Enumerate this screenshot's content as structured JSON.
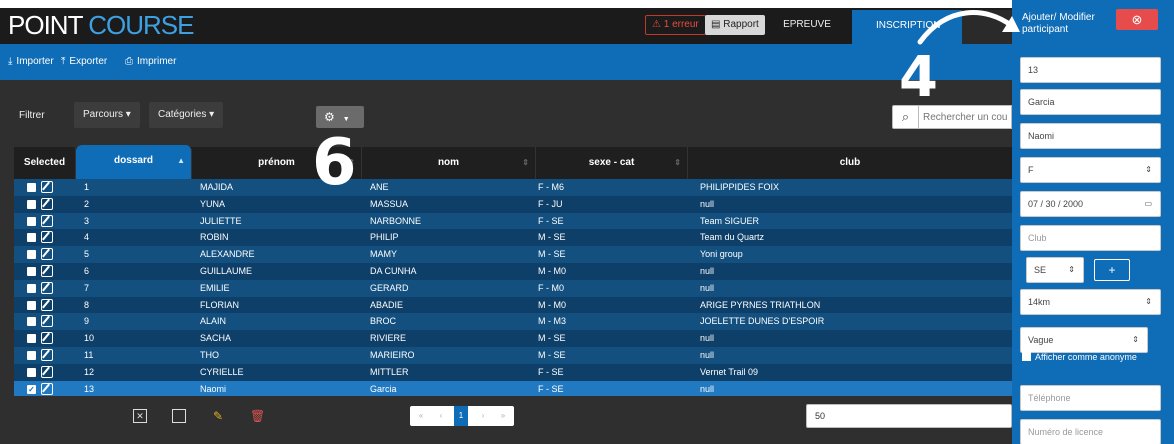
{
  "app": {
    "logo_part1": "POINT",
    "logo_part2": "COURSE"
  },
  "topnav": {
    "errors_label": "1 erreur",
    "report_label": "Rapport",
    "tab_epreuve": "EPREUVE",
    "tab_inscription": "INSCRIPTION"
  },
  "toolbar": {
    "import_label": "Importer",
    "export_label": "Exporter",
    "print_label": "Imprimer"
  },
  "filters": {
    "label": "Filtrer",
    "parcours_label": "Parcours",
    "categories_label": "Catégories"
  },
  "search": {
    "placeholder": "Rechercher un cou"
  },
  "table": {
    "columns": [
      "Selected",
      "dossard",
      "prénom",
      "nom",
      "sexe - cat",
      "club"
    ],
    "rows": [
      {
        "dossard": "1",
        "prenom": "MAJIDA",
        "nom": "ANE",
        "sexe_cat": "F - M6",
        "club": "PHILIPPIDES FOIX",
        "checked": false
      },
      {
        "dossard": "2",
        "prenom": "YUNA",
        "nom": "MASSUA",
        "sexe_cat": "F - JU",
        "club": "null",
        "checked": false
      },
      {
        "dossard": "3",
        "prenom": "JULIETTE",
        "nom": "NARBONNE",
        "sexe_cat": "F - SE",
        "club": "Team SIGUER",
        "checked": false
      },
      {
        "dossard": "4",
        "prenom": "ROBIN",
        "nom": "PHILIP",
        "sexe_cat": "M - SE",
        "club": "Team du Quartz",
        "checked": false
      },
      {
        "dossard": "5",
        "prenom": "ALEXANDRE",
        "nom": "MAMY",
        "sexe_cat": "M - SE",
        "club": "Yoni group",
        "checked": false
      },
      {
        "dossard": "6",
        "prenom": "GUILLAUME",
        "nom": "DA CUNHA",
        "sexe_cat": "M - M0",
        "club": "null",
        "checked": false
      },
      {
        "dossard": "7",
        "prenom": "EMILIE",
        "nom": "GERARD",
        "sexe_cat": "F - M0",
        "club": "null",
        "checked": false
      },
      {
        "dossard": "8",
        "prenom": "FLORIAN",
        "nom": "ABADIE",
        "sexe_cat": "M - M0",
        "club": "ARIGE PYRNES TRIATHLON",
        "checked": false
      },
      {
        "dossard": "9",
        "prenom": "ALAIN",
        "nom": "BROC",
        "sexe_cat": "M - M3",
        "club": "JOELETTE DUNES D'ESPOIR",
        "checked": false
      },
      {
        "dossard": "10",
        "prenom": "SACHA",
        "nom": "RIVIERE",
        "sexe_cat": "M - SE",
        "club": "null",
        "checked": false
      },
      {
        "dossard": "11",
        "prenom": "THO",
        "nom": "MARIEIRO",
        "sexe_cat": "M - SE",
        "club": "null",
        "checked": false
      },
      {
        "dossard": "12",
        "prenom": "CYRIELLE",
        "nom": "MITTLER",
        "sexe_cat": "F - SE",
        "club": "Vernet Trail 09",
        "checked": false
      },
      {
        "dossard": "13",
        "prenom": "Naomi",
        "nom": "Garcia",
        "sexe_cat": "F - SE",
        "club": "null",
        "checked": true
      }
    ]
  },
  "pagination": {
    "first": "«",
    "prev": "‹",
    "current": "1",
    "next": "›",
    "last": "»",
    "per_page": "50"
  },
  "panel": {
    "title": "Ajouter/ Modifier participant",
    "dossard": "13",
    "nom": "Garcia",
    "prenom": "Naomi",
    "sexe": "F",
    "birthdate": "07 / 30 / 2000",
    "club_placeholder": "Club",
    "categorie": "SE",
    "plus": "+",
    "parcours": "14km",
    "vague": "Vague",
    "anonymous_label": "Afficher comme anonyme",
    "phone_placeholder": "Téléphone",
    "licence_placeholder": "Numéro de licence"
  },
  "annotations": {
    "step_six": "6",
    "step_four": "4"
  },
  "colors": {
    "primary": "#0f6cb6",
    "dark_bg": "#2f2f2f",
    "row_odd": "#13507f",
    "row_even": "#0d3f69",
    "row_selected": "#2179c2",
    "danger": "#e74c4c",
    "edit_icon": "#e0b020",
    "delete_icon": "#d9534f"
  }
}
